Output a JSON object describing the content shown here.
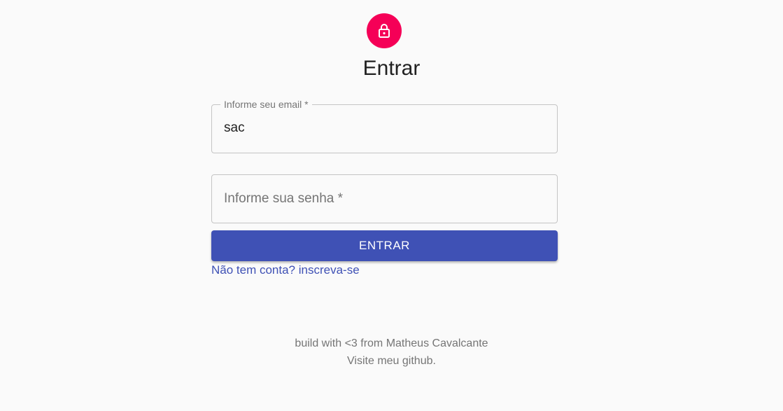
{
  "header": {
    "icon": "lock-icon",
    "title": "Entrar",
    "accent_color": "#f50057"
  },
  "form": {
    "email": {
      "label": "Informe seu email *",
      "value": "sac"
    },
    "password": {
      "label": "Informe sua senha *",
      "value": ""
    },
    "submit_label": "ENTRAR",
    "submit_color": "#3f51b5",
    "signup_link": "Não tem conta? inscreva-se"
  },
  "footer": {
    "credit": "build with <3 from Matheus Cavalcante",
    "github": "Visite meu github."
  }
}
